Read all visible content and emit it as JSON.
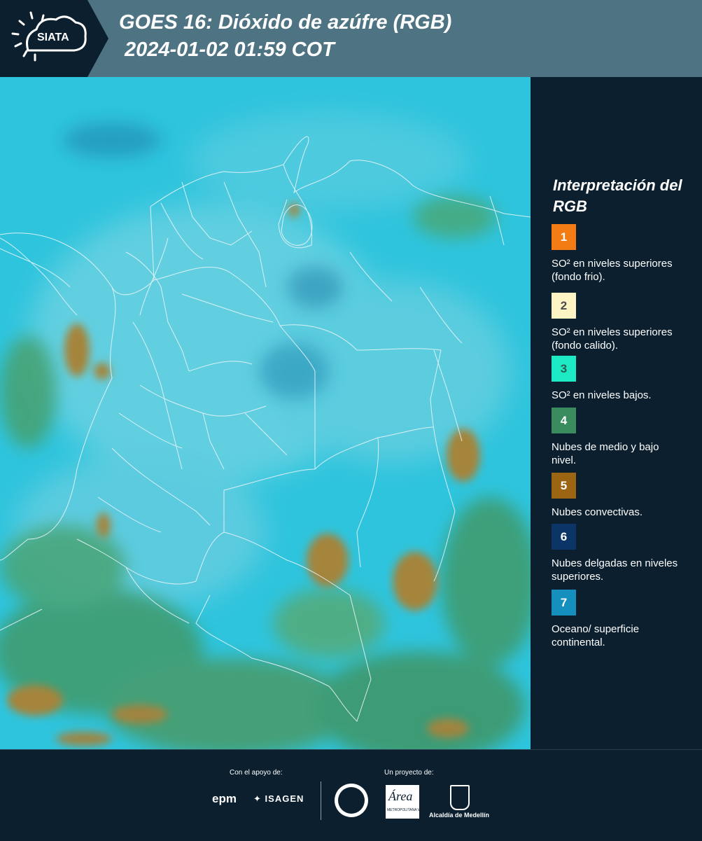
{
  "header": {
    "logo_text": "SIATA",
    "title_line1": "GOES 16: Dióxido de azúfre (RGB)",
    "title_line2": "2024-01-02 01:59 COT",
    "background": "#4e7484"
  },
  "legend": {
    "title": "Interpretación del RGB",
    "items": [
      {
        "number": "1",
        "color": "#f47c14",
        "text_color": "#ffffff",
        "label": "SO² en niveles superiores (fondo frio)."
      },
      {
        "number": "2",
        "color": "#fdf4c3",
        "text_color": "#4a4a4a",
        "label": "SO² en niveles superiores (fondo calido)."
      },
      {
        "number": "3",
        "color": "#1de9c4",
        "text_color": "#2a5a50",
        "label": "SO² en niveles bajos."
      },
      {
        "number": "4",
        "color": "#3a8b5e",
        "text_color": "#ffffff",
        "label": "Nubes de medio y bajo nivel."
      },
      {
        "number": "5",
        "color": "#9c6514",
        "text_color": "#ffffff",
        "label": "Nubes convectivas."
      },
      {
        "number": "6",
        "color": "#0b3566",
        "text_color": "#ffffff",
        "label": "Nubes delgadas en niveles superiores."
      },
      {
        "number": "7",
        "color": "#158fbd",
        "text_color": "#ffffff",
        "label": "Oceano/ superficie continental."
      }
    ]
  },
  "map": {
    "base_color": "#2ec4dd",
    "cloud_color": "#a0876a",
    "convective_color": "#a5843a",
    "border_color": "#e8f4f8"
  },
  "footer": {
    "support_label": "Con el apoyo de:",
    "project_label": "Un proyecto de:",
    "epm": "epm",
    "isagen": "ISAGEN",
    "area_logo": "Área",
    "area_sub": "METROPOLITANA Valle de Aburrá",
    "alcaldia": "Alcaldía de Medellín"
  }
}
